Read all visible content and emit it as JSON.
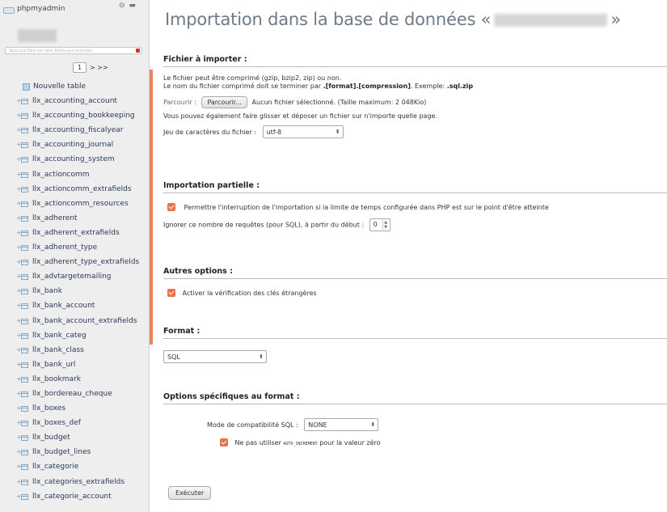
{
  "sidebar": {
    "app_name": "phpmyadmin",
    "filter_placeholder": "Tapez pour filtrer ces noms, Entrée pour rechercher",
    "page_select": "1",
    "page_nav": "> >>",
    "new_table_label": "Nouvelle table",
    "tables": [
      "llx_accounting_account",
      "llx_accounting_bookkeeping",
      "llx_accounting_fiscalyear",
      "llx_accounting_journal",
      "llx_accounting_system",
      "llx_actioncomm",
      "llx_actioncomm_extrafields",
      "llx_actioncomm_resources",
      "llx_adherent",
      "llx_adherent_extrafields",
      "llx_adherent_type",
      "llx_adherent_type_extrafields",
      "llx_advtargetemailing",
      "llx_bank",
      "llx_bank_account",
      "llx_bank_account_extrafields",
      "llx_bank_categ",
      "llx_bank_class",
      "llx_bank_url",
      "llx_bookmark",
      "llx_bordereau_cheque",
      "llx_boxes",
      "llx_boxes_def",
      "llx_budget",
      "llx_budget_lines",
      "llx_categorie",
      "llx_categories_extrafields",
      "llx_categorie_account"
    ]
  },
  "main": {
    "title_prefix": "Importation dans la base de données «",
    "title_suffix": "»",
    "file_section": {
      "heading": "Fichier à importer :",
      "compression_note": "Le fichier peut être comprimé (gzip, bzip2, zip) ou non.",
      "name_note_prefix": "Le nom du fichier comprimé doit se terminer par",
      "name_note_format": ".[format].[compression]",
      "name_note_example_label": ". Exemple:",
      "name_note_example": ".sql.zip",
      "browse_label": "Parcourir :",
      "browse_button": "Parcourir...",
      "no_file_text": "Aucun fichier sélectionné. (Taille maximum: 2 048Kio)",
      "drag_note": "Vous pouvez également faire glisser et déposer un fichier sur n'importe quelle page.",
      "charset_label": "Jeu de caractères du fichier :",
      "charset_value": "utf-8"
    },
    "partial_section": {
      "heading": "Importation partielle :",
      "interrupt_label": "Permettre l'interruption de l'importation si la limite de temps configurée dans PHP est sur le point d'être atteinte",
      "skip_label": "Ignorer ce nombre de requêtes (pour SQL), à partir du début :",
      "skip_value": "0"
    },
    "other_section": {
      "heading": "Autres options :",
      "fk_label": "Activer la vérification des clés étrangères"
    },
    "format_section": {
      "heading": "Format :",
      "format_value": "SQL"
    },
    "format_options_section": {
      "heading": "Options spécifiques au format :",
      "compat_label": "Mode de compatibilité SQL :",
      "compat_value": "NONE",
      "auto_inc_label_prefix": "Ne pas utiliser",
      "auto_inc_keyword": "AUTO_INCREMENT",
      "auto_inc_label_suffix": "pour la valeur zéro"
    },
    "execute_button": "Exécuter"
  },
  "colors": {
    "accent_orange": "#e8734a",
    "title_gray": "#6e7b86"
  }
}
